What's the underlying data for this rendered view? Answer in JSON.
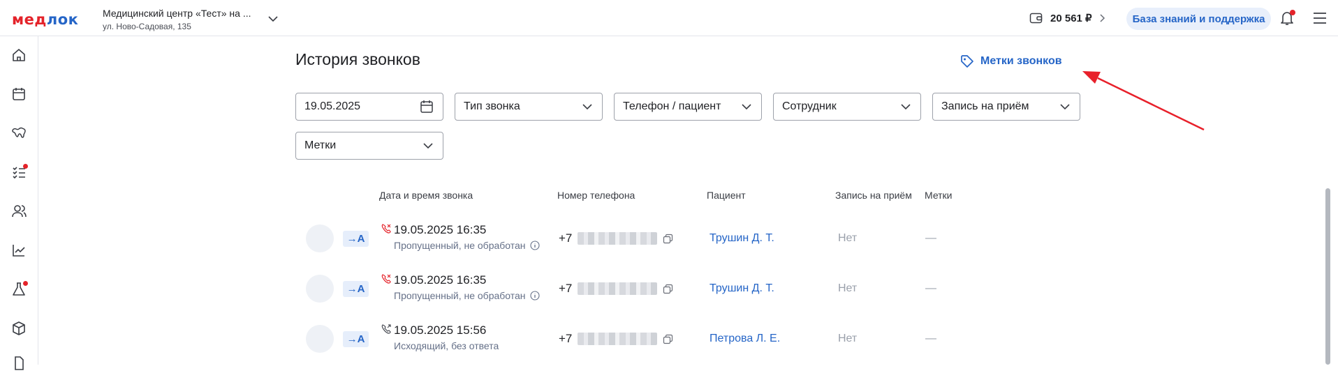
{
  "header": {
    "logo_part1": "мед",
    "logo_part2": "лок",
    "clinic_name": "Медицинский центр «Тест» на ...",
    "clinic_address": "ул. Ново-Садовая, 135",
    "balance": "20 561 ₽",
    "knowledge_base_label": "База знаний и поддержка"
  },
  "sidebar": {
    "items": [
      {
        "icon": "home-icon"
      },
      {
        "icon": "calendar-icon"
      },
      {
        "icon": "teeth-icon"
      },
      {
        "icon": "tasks-icon",
        "badge": true
      },
      {
        "icon": "users-icon"
      },
      {
        "icon": "analytics-icon"
      },
      {
        "icon": "lab-flask-icon",
        "badge": true
      },
      {
        "icon": "box-icon"
      },
      {
        "icon": "document-icon"
      }
    ]
  },
  "page": {
    "title": "История звонков",
    "tags_link": "Метки звонков"
  },
  "filters": {
    "date": "19.05.2025",
    "call_type": "Тип звонка",
    "phone_patient": "Телефон / пациент",
    "employee": "Сотрудник",
    "appointment": "Запись на приём",
    "tags": "Метки"
  },
  "table": {
    "headers": {
      "datetime": "Дата и время звонка",
      "phone": "Номер телефона",
      "patient": "Пациент",
      "appointment": "Запись на приём",
      "tags": "Метки"
    },
    "rows": [
      {
        "direction": "→A",
        "call_icon": "missed-call-icon",
        "datetime": "19.05.2025 16:35",
        "status": "Пропущенный, не обработан",
        "phone_prefix": "+7",
        "patient": "Трушин Д. Т.",
        "appointment": "Нет",
        "tags": "—"
      },
      {
        "direction": "→A",
        "call_icon": "missed-call-icon",
        "datetime": "19.05.2025 16:35",
        "status": "Пропущенный, не обработан",
        "phone_prefix": "+7",
        "patient": "Трушин Д. Т.",
        "appointment": "Нет",
        "tags": "—"
      },
      {
        "direction": "→A",
        "call_icon": "outgoing-call-icon",
        "datetime": "19.05.2025 15:56",
        "status": "Исходящий, без ответа",
        "phone_prefix": "+7",
        "patient": "Петрова Л. Е.",
        "appointment": "Нет",
        "tags": "—"
      }
    ]
  },
  "colors": {
    "brand_red": "#e4232a",
    "brand_blue": "#2565c7",
    "annotation_arrow": "#e8202a"
  }
}
